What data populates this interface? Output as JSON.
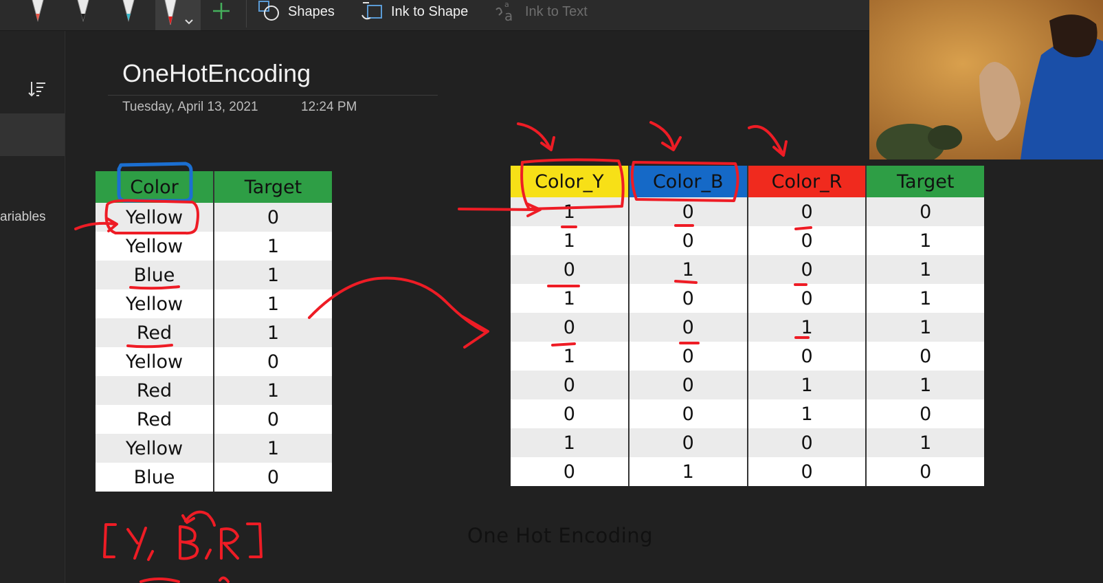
{
  "ribbon": {
    "shapes_label": "Shapes",
    "ink_to_shape_label": "Ink to Shape",
    "ink_to_text_label": "Ink to Text"
  },
  "sidebar": {
    "partial_label": "ariables"
  },
  "page": {
    "title": "OneHotEncoding",
    "date": "Tuesday, April 13, 2021",
    "time": "12:24 PM"
  },
  "colors": {
    "header_green": "#2e9e45",
    "header_yellow": "#f7e017",
    "header_blue": "#1569c7",
    "header_red": "#f02a1e",
    "ink_red": "#ee1c25",
    "ink_blue": "#1b6fd1"
  },
  "original_table": {
    "headers": [
      "Color",
      "Target"
    ],
    "rows": [
      [
        "Yellow",
        "0"
      ],
      [
        "Yellow",
        "1"
      ],
      [
        "Blue",
        "1"
      ],
      [
        "Yellow",
        "1"
      ],
      [
        "Red",
        "1"
      ],
      [
        "Yellow",
        "0"
      ],
      [
        "Red",
        "1"
      ],
      [
        "Red",
        "0"
      ],
      [
        "Yellow",
        "1"
      ],
      [
        "Blue",
        "0"
      ]
    ]
  },
  "encoded_table": {
    "headers": [
      "Color_Y",
      "Color_B",
      "Color_R",
      "Target"
    ],
    "rows": [
      [
        "1",
        "0",
        "0",
        "0"
      ],
      [
        "1",
        "0",
        "0",
        "1"
      ],
      [
        "0",
        "1",
        "0",
        "1"
      ],
      [
        "1",
        "0",
        "0",
        "1"
      ],
      [
        "0",
        "0",
        "1",
        "1"
      ],
      [
        "1",
        "0",
        "0",
        "0"
      ],
      [
        "0",
        "0",
        "1",
        "1"
      ],
      [
        "0",
        "0",
        "1",
        "0"
      ],
      [
        "1",
        "0",
        "0",
        "1"
      ],
      [
        "0",
        "1",
        "0",
        "0"
      ]
    ]
  },
  "caption": "One Hot Encoding",
  "handwriting": "[Y, B, R]"
}
